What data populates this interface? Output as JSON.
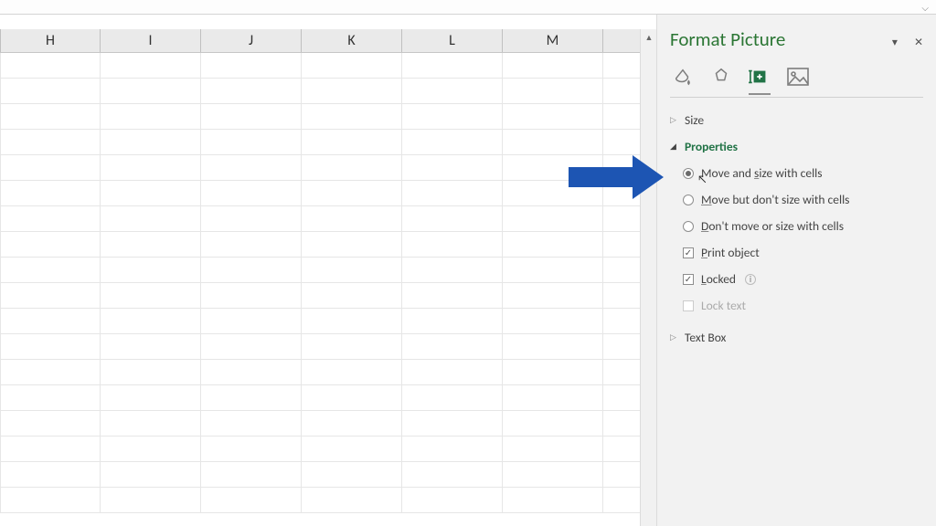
{
  "columns": [
    "H",
    "I",
    "J",
    "K",
    "L",
    "M"
  ],
  "rowCount": 18,
  "pane": {
    "title": "Format Picture",
    "tabs": [
      "fill-line",
      "effects",
      "size-properties",
      "picture"
    ],
    "activeTab": 2,
    "sections": {
      "size": {
        "label": "Size",
        "open": false
      },
      "properties": {
        "label": "Properties",
        "open": true,
        "moveRadio": {
          "selected": 0,
          "options": [
            {
              "pre": "Move and ",
              "u": "s",
              "post": "ize with cells"
            },
            {
              "pre": "",
              "u": "M",
              "post": "ove but don't size with cells"
            },
            {
              "pre": "",
              "u": "D",
              "post": "on't move or size with cells"
            }
          ]
        },
        "printObject": {
          "checked": true,
          "pre": "",
          "u": "P",
          "post": "rint object"
        },
        "locked": {
          "checked": true,
          "pre": "",
          "u": "L",
          "post": "ocked"
        },
        "lockText": {
          "checked": false,
          "disabled": true,
          "label": "Lock text"
        }
      },
      "textBox": {
        "label": "Text Box",
        "open": false
      }
    }
  }
}
